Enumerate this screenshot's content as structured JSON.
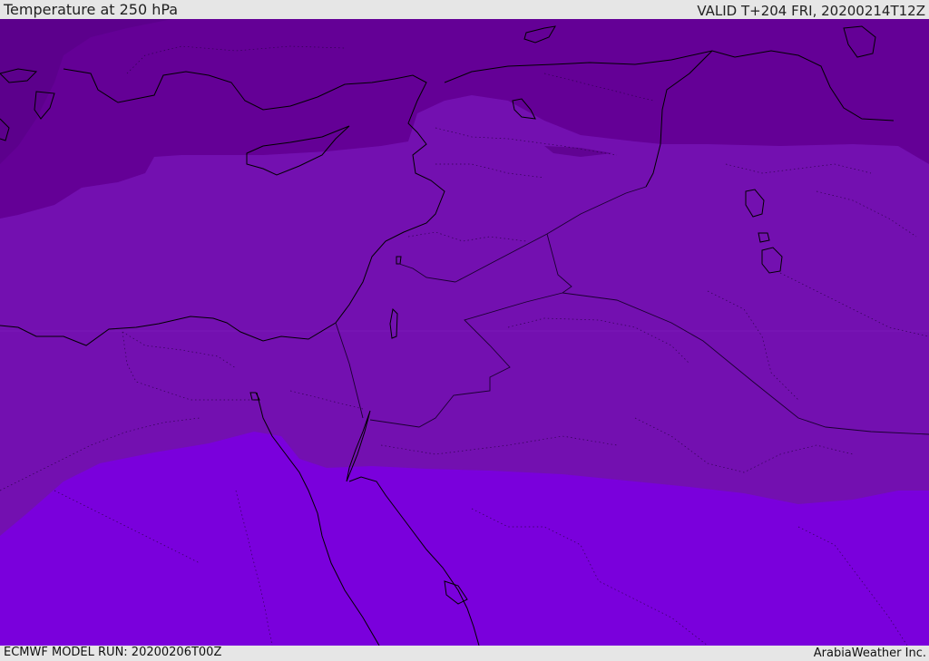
{
  "header": {
    "title": "Temperature at 250 hPa",
    "valid": "VALID T+204 FRI, 20200214T12Z"
  },
  "footer": {
    "model_run": "ECMWF MODEL RUN: 20200206T00Z",
    "credit": "ArabiaWeather Inc."
  },
  "map": {
    "field": "Temperature at 250 hPa",
    "colors": {
      "band_darkest": "#5a0088",
      "band_dark": "#640096",
      "band_mid": "#7310b0",
      "band_light": "#7a00dc",
      "coastline": "#000000",
      "borders": "#1a0030"
    }
  }
}
